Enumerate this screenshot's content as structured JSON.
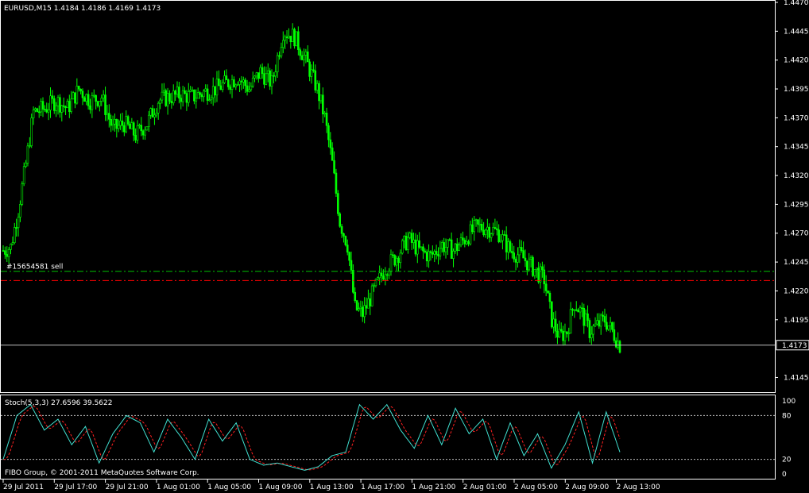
{
  "window": {
    "symbol_header": "EURUSD,M15  1.4184 1.4186 1.4169 1.4173"
  },
  "colors": {
    "background": "#000000",
    "grid_frame": "#ffffff",
    "bull_candle": "#00ff00",
    "order_line": "#00c000",
    "stop_line": "#ff0000",
    "stoch_main": "#40e0d0",
    "stoch_signal": "#ff2020",
    "level_line": "#c0c0c0"
  },
  "order": {
    "label": "#15654581 sell",
    "entry_price": 1.4237,
    "stop_price": 1.4229
  },
  "price_axis": {
    "ticks": [
      "1.4470",
      "1.4445",
      "1.4420",
      "1.4395",
      "1.4370",
      "1.4345",
      "1.4320",
      "1.4295",
      "1.4270",
      "1.4245",
      "1.4220",
      "1.4195",
      "1.4145"
    ],
    "current_price_label": "1.4173",
    "current_price": 1.4173,
    "range": [
      1.4135,
      1.447
    ]
  },
  "time_axis": {
    "labels": [
      "29 Jul 2011",
      "29 Jul 17:00",
      "29 Jul 21:00",
      "1 Aug 01:00",
      "1 Aug 05:00",
      "1 Aug 09:00",
      "1 Aug 13:00",
      "1 Aug 17:00",
      "1 Aug 21:00",
      "2 Aug 01:00",
      "2 Aug 05:00",
      "2 Aug 09:00",
      "2 Aug 13:00"
    ]
  },
  "stochastic": {
    "header": "Stoch(5,3,3) 27.6596 39.5622",
    "axis_labels": [
      "100",
      "80",
      "20",
      "0"
    ],
    "levels": [
      80,
      20
    ],
    "range": [
      0,
      100
    ]
  },
  "footer": {
    "copyright": "FIBO Group, © 2001-2011 MetaQuotes Software Corp."
  },
  "chart_data": {
    "type": "candlestick",
    "price_anchors_x_index_close": [
      [
        0,
        1.4255
      ],
      [
        4,
        1.4258
      ],
      [
        8,
        1.429
      ],
      [
        12,
        1.433
      ],
      [
        16,
        1.4375
      ],
      [
        22,
        1.4378
      ],
      [
        28,
        1.4385
      ],
      [
        34,
        1.4378
      ],
      [
        40,
        1.4395
      ],
      [
        46,
        1.4385
      ],
      [
        52,
        1.4388
      ],
      [
        58,
        1.436
      ],
      [
        64,
        1.4365
      ],
      [
        70,
        1.4355
      ],
      [
        76,
        1.4365
      ],
      [
        82,
        1.4385
      ],
      [
        88,
        1.4388
      ],
      [
        94,
        1.439
      ],
      [
        100,
        1.4388
      ],
      [
        106,
        1.4392
      ],
      [
        112,
        1.4395
      ],
      [
        118,
        1.44
      ],
      [
        124,
        1.4405
      ],
      [
        130,
        1.4395
      ],
      [
        136,
        1.441
      ],
      [
        142,
        1.44
      ],
      [
        148,
        1.4445
      ],
      [
        154,
        1.444
      ],
      [
        160,
        1.442
      ],
      [
        166,
        1.4395
      ],
      [
        170,
        1.437
      ],
      [
        174,
        1.433
      ],
      [
        178,
        1.428
      ],
      [
        182,
        1.426
      ],
      [
        186,
        1.4205
      ],
      [
        190,
        1.42
      ],
      [
        196,
        1.422
      ],
      [
        202,
        1.424
      ],
      [
        208,
        1.425
      ],
      [
        214,
        1.4265
      ],
      [
        220,
        1.4255
      ],
      [
        226,
        1.425
      ],
      [
        232,
        1.426
      ],
      [
        238,
        1.4255
      ],
      [
        244,
        1.4265
      ],
      [
        250,
        1.4275
      ],
      [
        256,
        1.4275
      ],
      [
        262,
        1.427
      ],
      [
        268,
        1.4255
      ],
      [
        274,
        1.425
      ],
      [
        280,
        1.424
      ],
      [
        286,
        1.423
      ],
      [
        290,
        1.4195
      ],
      [
        294,
        1.418
      ],
      [
        298,
        1.4185
      ],
      [
        302,
        1.421
      ],
      [
        306,
        1.42
      ],
      [
        310,
        1.4185
      ],
      [
        314,
        1.419
      ],
      [
        318,
        1.4195
      ],
      [
        322,
        1.4185
      ],
      [
        326,
        1.4173
      ]
    ],
    "stochastic_main_anchors": [
      [
        0,
        20
      ],
      [
        6,
        80
      ],
      [
        12,
        95
      ],
      [
        18,
        60
      ],
      [
        24,
        75
      ],
      [
        30,
        40
      ],
      [
        36,
        65
      ],
      [
        42,
        15
      ],
      [
        48,
        55
      ],
      [
        54,
        80
      ],
      [
        60,
        70
      ],
      [
        66,
        30
      ],
      [
        72,
        75
      ],
      [
        78,
        50
      ],
      [
        84,
        20
      ],
      [
        90,
        75
      ],
      [
        96,
        45
      ],
      [
        102,
        70
      ],
      [
        108,
        20
      ],
      [
        114,
        12
      ],
      [
        120,
        15
      ],
      [
        126,
        10
      ],
      [
        132,
        5
      ],
      [
        138,
        10
      ],
      [
        144,
        25
      ],
      [
        150,
        30
      ],
      [
        156,
        95
      ],
      [
        162,
        75
      ],
      [
        168,
        95
      ],
      [
        174,
        60
      ],
      [
        180,
        35
      ],
      [
        186,
        80
      ],
      [
        192,
        40
      ],
      [
        198,
        90
      ],
      [
        204,
        55
      ],
      [
        210,
        75
      ],
      [
        216,
        20
      ],
      [
        222,
        70
      ],
      [
        228,
        25
      ],
      [
        234,
        55
      ],
      [
        240,
        8
      ],
      [
        246,
        40
      ],
      [
        252,
        85
      ],
      [
        258,
        15
      ],
      [
        264,
        85
      ],
      [
        270,
        30
      ]
    ],
    "x_count": 327
  }
}
